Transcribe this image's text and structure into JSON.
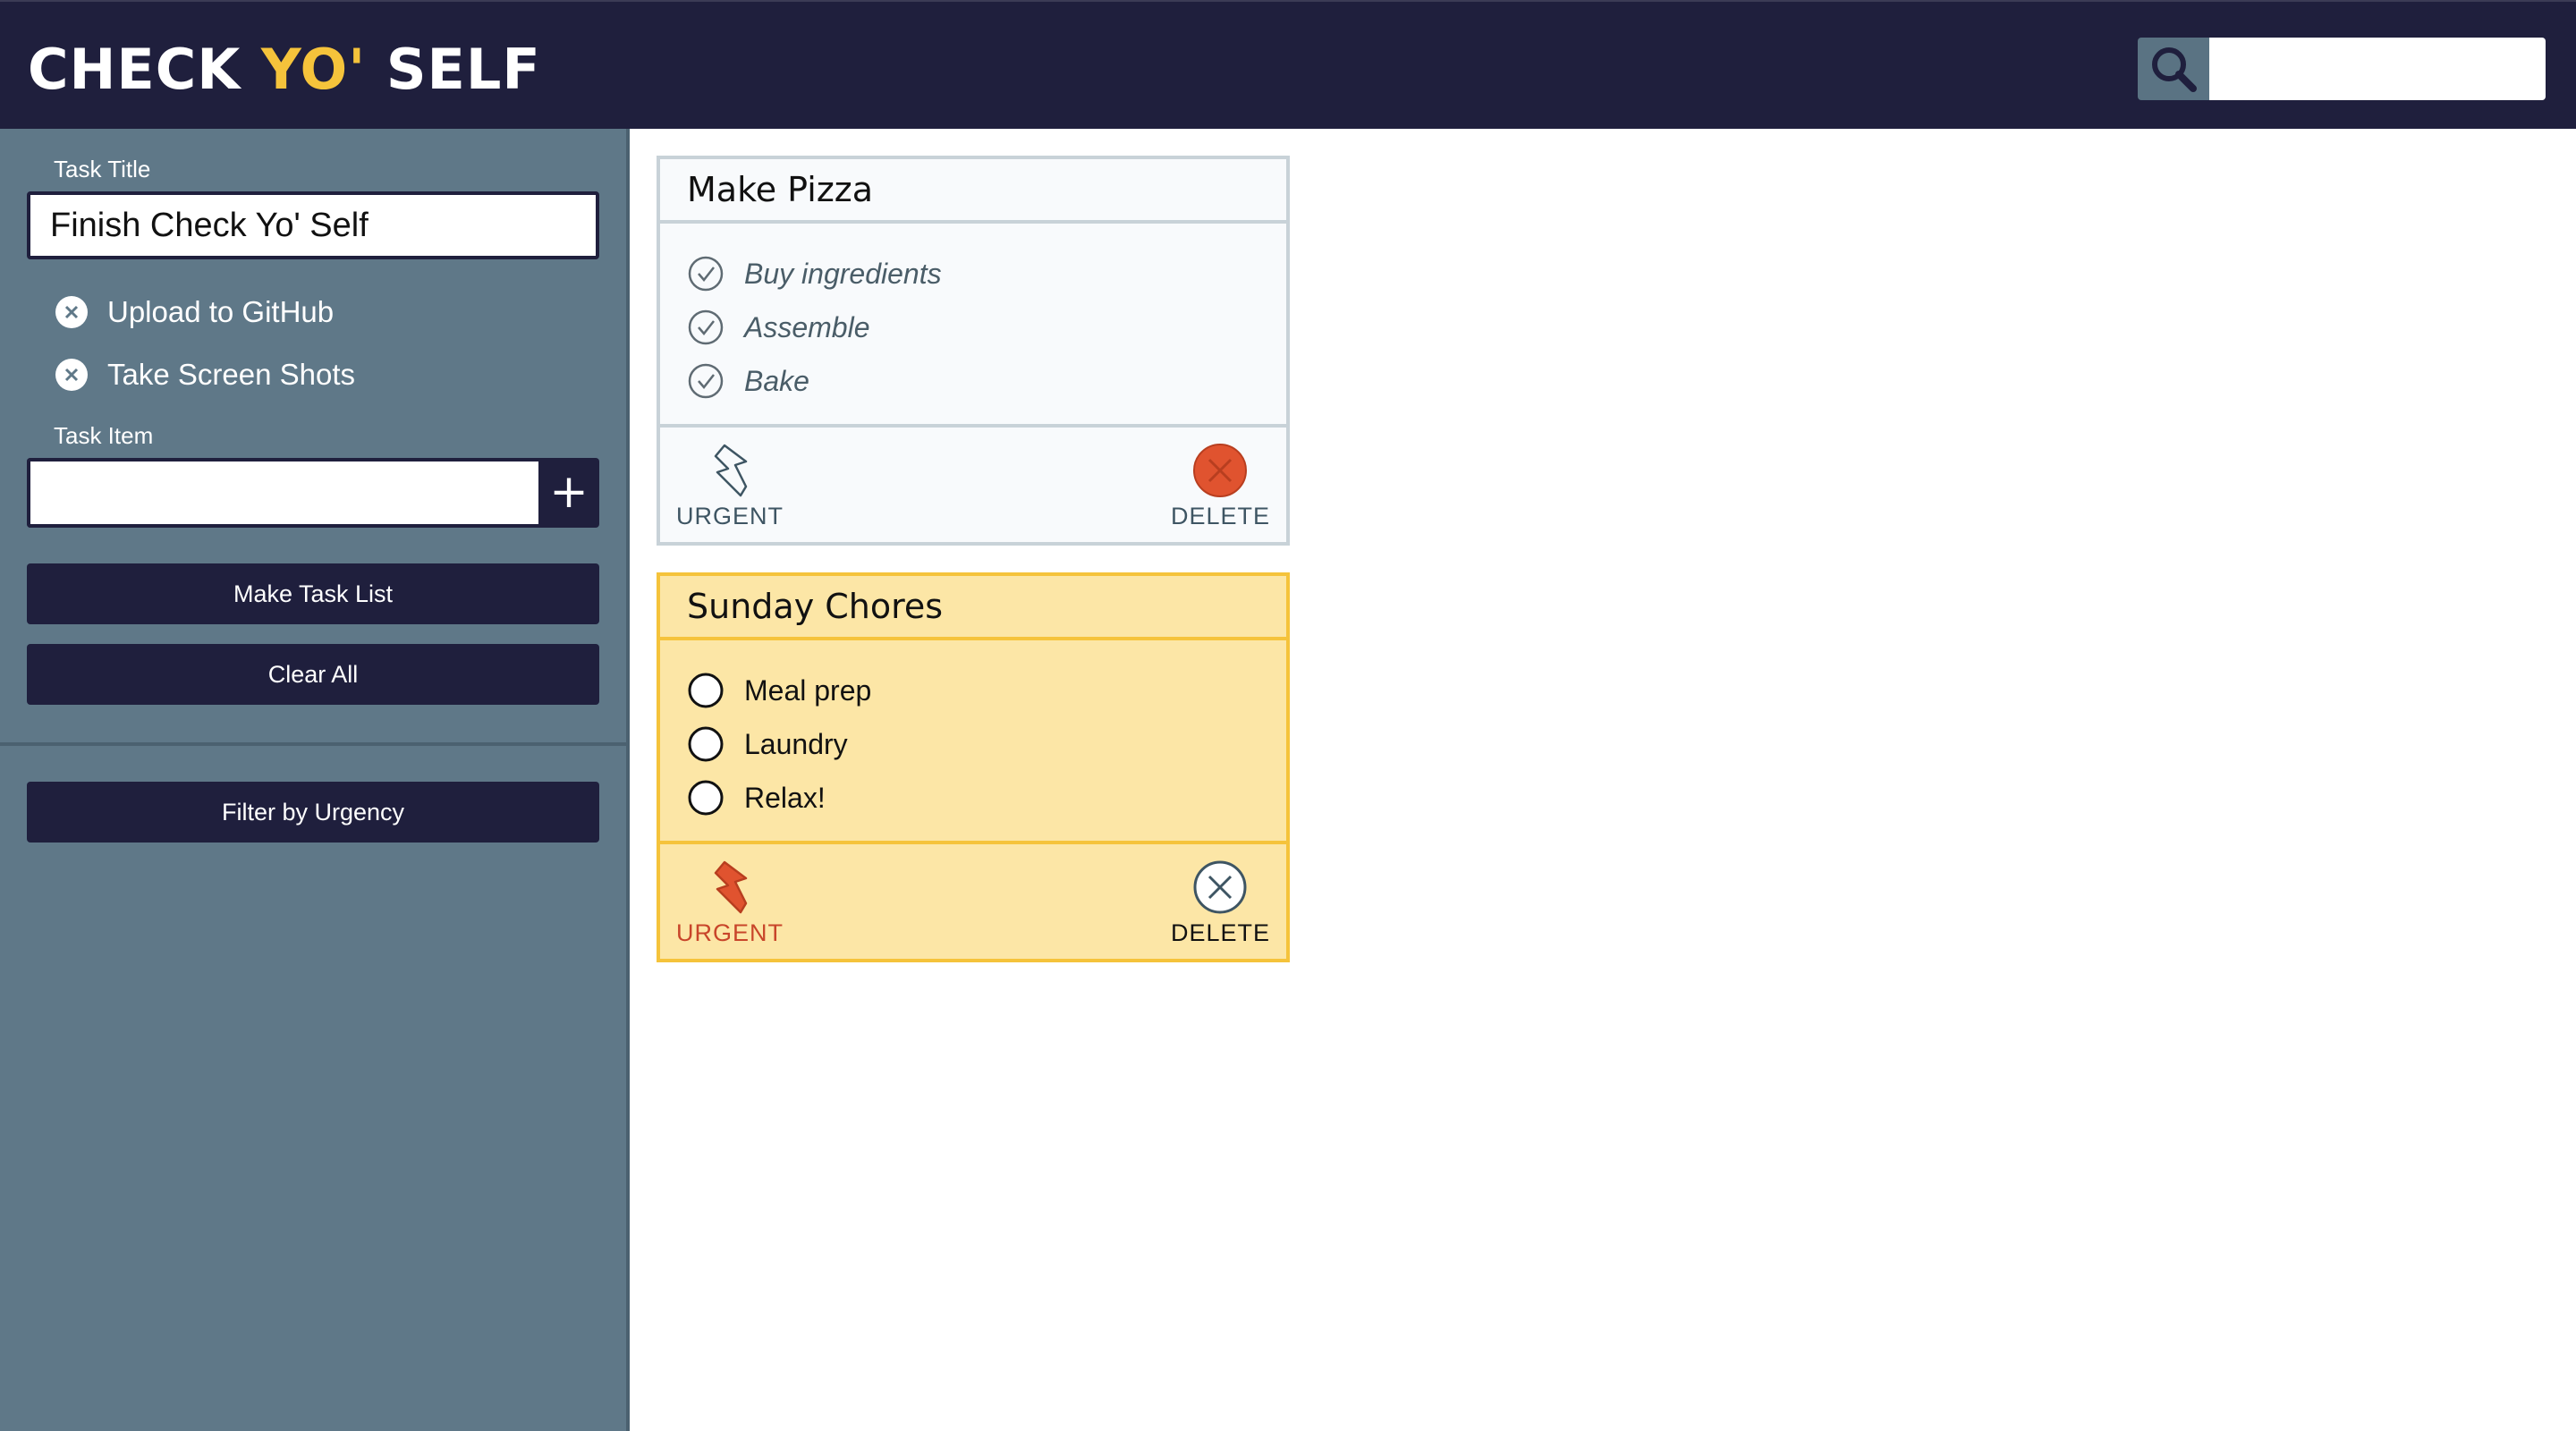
{
  "header": {
    "logo_part1": "CHECK ",
    "logo_accent": "YO'",
    "logo_part2": " SELF",
    "search_placeholder": ""
  },
  "colors": {
    "navy": "#1f1f3d",
    "slate": "#5f7888",
    "accent_yellow": "#f5c33b",
    "urgent_card_bg": "#fce6a6",
    "urgent_red": "#e0532f"
  },
  "sidebar": {
    "task_title_label": "Task Title",
    "task_title_value": "Finish Check Yo' Self",
    "draft_items": [
      {
        "text": "Upload to GitHub",
        "icon": "remove-circle-icon"
      },
      {
        "text": "Take Screen Shots",
        "icon": "remove-circle-icon"
      }
    ],
    "task_item_label": "Task Item",
    "task_item_value": "",
    "add_label": "+",
    "make_task_list_label": "Make Task List",
    "clear_all_label": "Clear All",
    "filter_label": "Filter by Urgency"
  },
  "cards": [
    {
      "title": "Make Pizza",
      "urgent": false,
      "tasks": [
        {
          "text": "Buy ingredients",
          "checked": true
        },
        {
          "text": "Assemble",
          "checked": true
        },
        {
          "text": "Bake",
          "checked": true
        }
      ],
      "urgent_label": "URGENT",
      "delete_label": "DELETE",
      "delete_active": true
    },
    {
      "title": "Sunday Chores",
      "urgent": true,
      "tasks": [
        {
          "text": "Meal prep",
          "checked": false
        },
        {
          "text": "Laundry",
          "checked": false
        },
        {
          "text": "Relax!",
          "checked": false
        }
      ],
      "urgent_label": "URGENT",
      "delete_label": "DELETE",
      "delete_active": false
    }
  ]
}
